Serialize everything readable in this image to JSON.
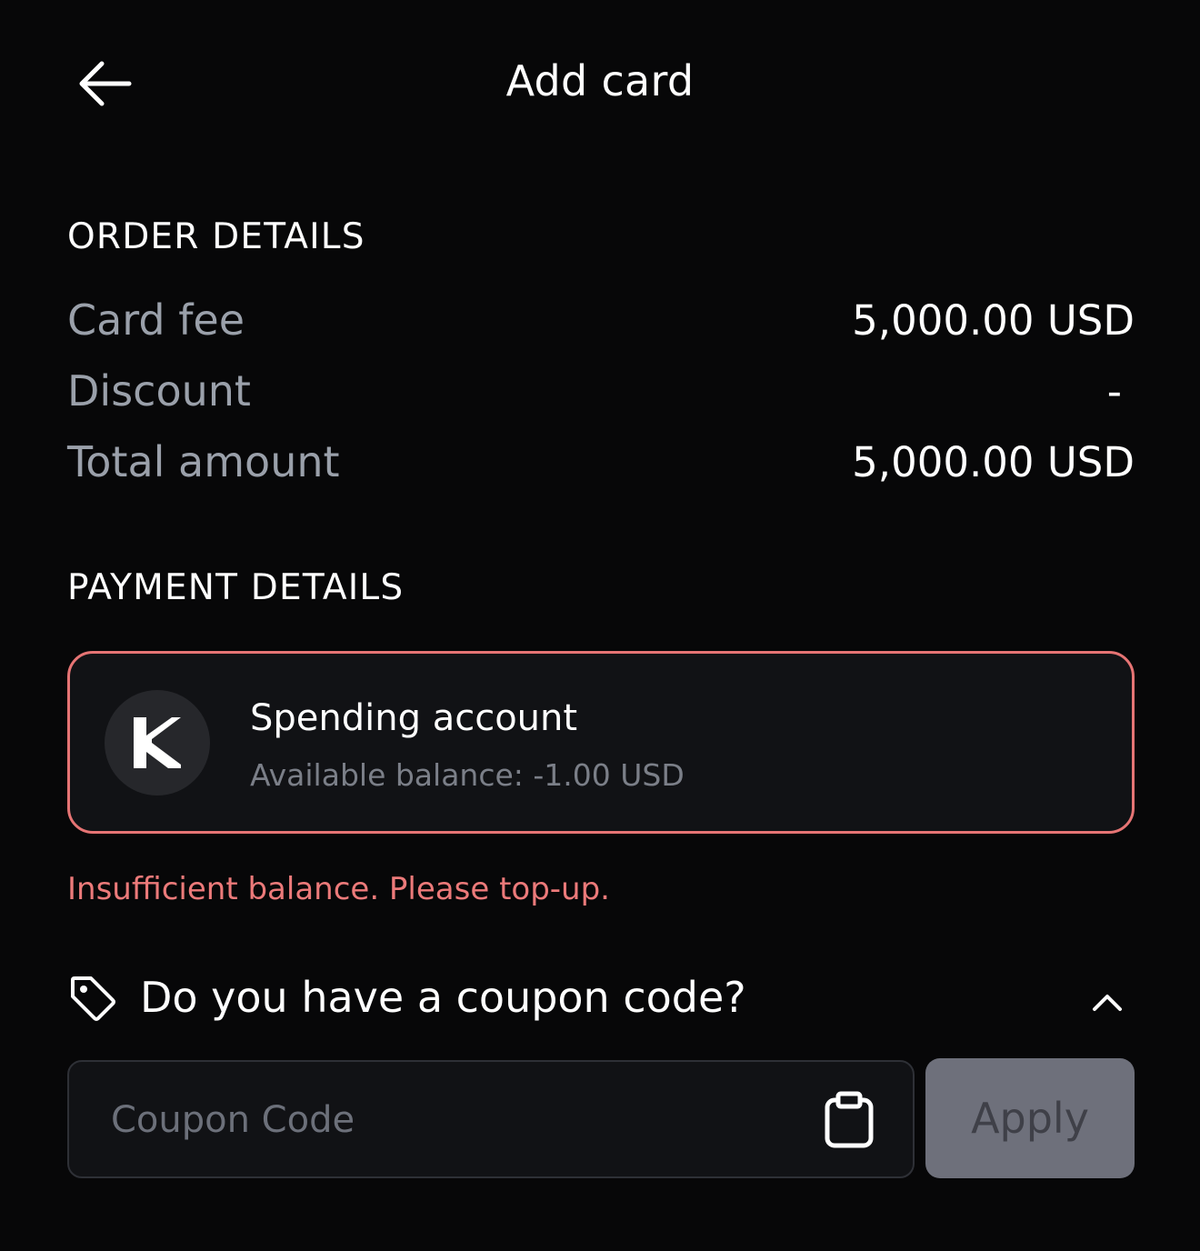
{
  "header": {
    "title": "Add card",
    "back_icon": "arrow-left-icon"
  },
  "order_details": {
    "heading": "ORDER DETAILS",
    "rows": [
      {
        "label": "Card fee",
        "value": "5,000.00 USD"
      },
      {
        "label": "Discount",
        "value": "-"
      },
      {
        "label": "Total amount",
        "value": "5,000.00 USD"
      }
    ]
  },
  "payment_details": {
    "heading": "PAYMENT DETAILS",
    "account": {
      "name": "Spending account",
      "balance": "Available balance: -1.00 USD",
      "logo_icon": "brand-k-logo-icon"
    },
    "error": "Insufficient balance. Please top-up.",
    "error_color": "#ec7a7a"
  },
  "coupon": {
    "question": "Do you have a coupon code?",
    "tag_icon": "tag-icon",
    "toggle_icon": "chevron-up-icon",
    "placeholder": "Coupon Code",
    "value": "",
    "paste_icon": "clipboard-icon",
    "apply_label": "Apply"
  },
  "colors": {
    "background": "#070708",
    "error_border": "#e67474",
    "apply_disabled_bg": "#6e707b"
  }
}
